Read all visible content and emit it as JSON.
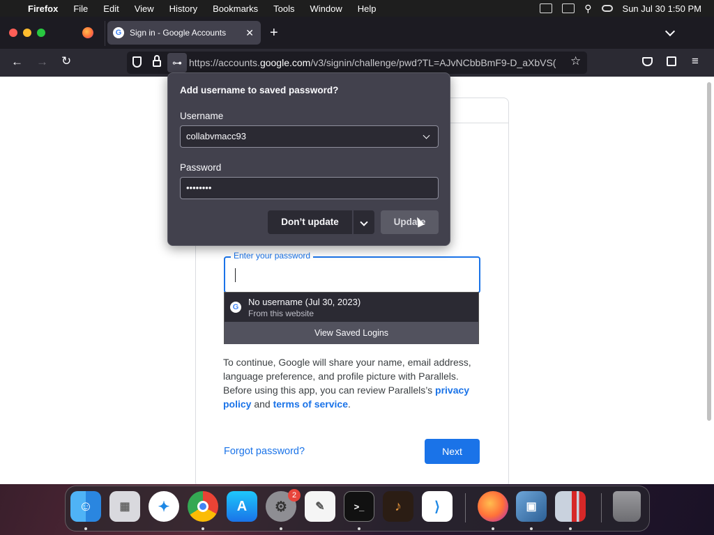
{
  "menubar": {
    "app_name": "Firefox",
    "items": [
      "File",
      "Edit",
      "View",
      "History",
      "Bookmarks",
      "Tools",
      "Window",
      "Help"
    ],
    "clock": "Sun Jul 30  1:50 PM"
  },
  "tab": {
    "title": "Sign in - Google Accounts",
    "favicon_letter": "G"
  },
  "navbar": {
    "url_prefix": "https://accounts.",
    "url_domain": "google.com",
    "url_rest": "/v3/signin/challenge/pwd?TL=AJvNCbbBmF9-D_aXbVS("
  },
  "doorhanger": {
    "title": "Add username to saved password?",
    "username_label": "Username",
    "username_value": "collabvmacc93",
    "password_label": "Password",
    "password_value": "••••••••",
    "dont_update": "Don’t update",
    "update": "Update"
  },
  "login": {
    "password_label": "Enter your password",
    "autocomplete": {
      "item_title": "No username (Jul 30, 2023)",
      "item_subtitle": "From this website",
      "view_saved": "View Saved Logins"
    },
    "consent_text": "To continue, Google will share your name, email address, language preference, and profile picture with Parallels. Before using this app, you can review Parallels’s",
    "privacy_link": "privacy policy",
    "and_text": "and",
    "terms_link": "terms of service",
    "period": ".",
    "forgot": "Forgot password?",
    "next": "Next"
  },
  "dock": {
    "badge_count": "2",
    "apps": [
      "finder-icon",
      "launchpad-icon",
      "safari-icon",
      "chrome-icon",
      "app-store-icon",
      "system-settings-icon",
      "textedit-icon",
      "terminal-icon",
      "garageband-icon",
      "vscode-icon",
      "firefox-icon",
      "virtualbox-icon",
      "parallels-icon",
      "trash-icon"
    ]
  },
  "colors": {
    "accent": "#1a73e8",
    "firefox_chrome": "#2b2a33",
    "doorhanger": "#42414d"
  }
}
